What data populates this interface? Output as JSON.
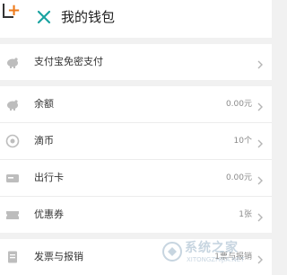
{
  "header": {
    "title": "我的钱包",
    "close_icon": "close-icon"
  },
  "colors": {
    "accent_close": "#1aa3a1",
    "logo_orange": "#ee7a1a",
    "background": "#f1f1f1",
    "icon_gray": "#bdbdbd"
  },
  "groups": [
    {
      "rows": [
        {
          "label": "支付宝免密支付",
          "value": "",
          "icon": "piggy-bank-icon"
        }
      ]
    },
    {
      "rows": [
        {
          "label": "余额",
          "value": "0.00元",
          "icon": "piggy-bank-icon"
        },
        {
          "label": "滴币",
          "value": "10个",
          "icon": "coin-icon"
        },
        {
          "label": "出行卡",
          "value": "0.00元",
          "icon": "card-icon"
        },
        {
          "label": "优惠券",
          "value": "1张",
          "icon": "coupon-icon"
        }
      ]
    },
    {
      "rows": [
        {
          "label": "发票与报销",
          "value": "1票与报销",
          "icon": "invoice-icon"
        }
      ]
    }
  ],
  "watermark": {
    "text": "系统之家",
    "sub": "XITONGZHIJIA.NET"
  }
}
